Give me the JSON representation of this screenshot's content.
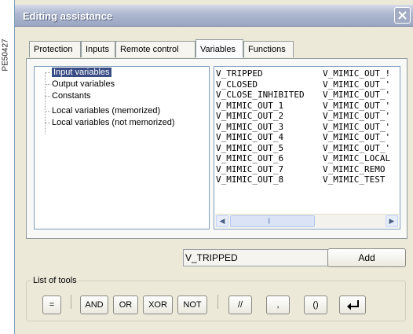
{
  "side_code": "PE50427",
  "window": {
    "title": "Editing assistance"
  },
  "tabs": [
    {
      "label": "Protection"
    },
    {
      "label": "Inputs"
    },
    {
      "label": "Remote control"
    },
    {
      "label": "Variables",
      "active": true
    },
    {
      "label": "Functions"
    }
  ],
  "tree": {
    "items": [
      {
        "label": "Input variables",
        "selected": true
      },
      {
        "label": "Output variables"
      },
      {
        "label": "Constants"
      },
      {
        "label": "Local variables (memorized)"
      },
      {
        "label": "Local variables (not memorized)"
      }
    ]
  },
  "variables": {
    "col1": [
      "V_TRIPPED",
      "V_CLOSED",
      "V_CLOSE_INHIBITED",
      "V_MIMIC_OUT_1",
      "V_MIMIC_OUT_2",
      "V_MIMIC_OUT_3",
      "V_MIMIC_OUT_4",
      "V_MIMIC_OUT_5",
      "V_MIMIC_OUT_6",
      "V_MIMIC_OUT_7",
      "V_MIMIC_OUT_8"
    ],
    "col2": [
      "V_MIMIC_OUT_!",
      "V_MIMIC_OUT_'",
      "V_MIMIC_OUT_'",
      "V_MIMIC_OUT_'",
      "V_MIMIC_OUT_'",
      "V_MIMIC_OUT_'",
      "V_MIMIC_OUT_'",
      "V_MIMIC_OUT_'",
      "V_MIMIC_LOCAL",
      "V_MIMIC_REMO",
      "V_MIMIC_TEST"
    ],
    "scroll_left_icon": "◀",
    "scroll_right_icon": "▶",
    "scroll_grip": "|||"
  },
  "selected_value": "V_TRIPPED",
  "add_label": "Add",
  "tools": {
    "legend": "List of tools",
    "buttons": [
      "=",
      "AND",
      "OR",
      "XOR",
      "NOT",
      "//",
      ",",
      "()"
    ],
    "enter_icon": "enter-icon"
  }
}
